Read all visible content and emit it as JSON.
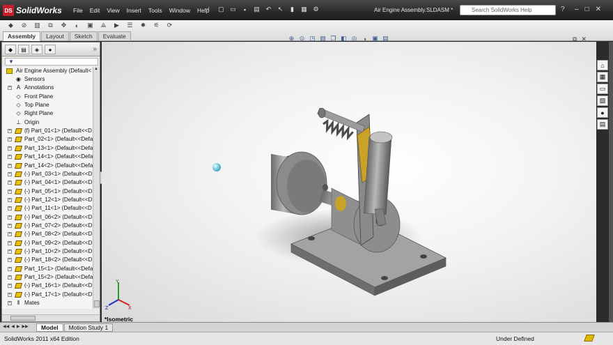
{
  "app": {
    "brand": "SolidWorks",
    "brand_badge": "DS"
  },
  "menu": [
    "File",
    "Edit",
    "View",
    "Insert",
    "Tools",
    "Window",
    "Help"
  ],
  "document_title": "Air Engine Assembly.SLDASM *",
  "search": {
    "placeholder": "Search SolidWorks Help"
  },
  "command_tabs": [
    {
      "label": "Assembly",
      "active": true
    },
    {
      "label": "Layout",
      "active": false
    },
    {
      "label": "Sketch",
      "active": false
    },
    {
      "label": "Evaluate",
      "active": false
    }
  ],
  "feature_tree": {
    "filter_symbol": "▼",
    "root": "Air Engine Assembly  (Default<",
    "items": [
      {
        "label": "Sensors",
        "icon": "sensors-icon",
        "expandable": false
      },
      {
        "label": "Annotations",
        "icon": "annotations-icon",
        "expandable": true
      },
      {
        "label": "Front Plane",
        "icon": "plane-icon",
        "expandable": false
      },
      {
        "label": "Top Plane",
        "icon": "plane-icon",
        "expandable": false
      },
      {
        "label": "Right Plane",
        "icon": "plane-icon",
        "expandable": false
      },
      {
        "label": "Origin",
        "icon": "origin-icon",
        "expandable": false
      },
      {
        "label": "(f) Part_01<1> (Default<<D",
        "icon": "part-icon",
        "expandable": true
      },
      {
        "label": "Part_02<1> (Default<<Defa",
        "icon": "part-icon",
        "expandable": true
      },
      {
        "label": "Part_13<1> (Default<<Defa",
        "icon": "part-icon",
        "expandable": true
      },
      {
        "label": "Part_14<1> (Default<<Defa",
        "icon": "part-icon",
        "expandable": true
      },
      {
        "label": "Part_14<2> (Default<<Defa",
        "icon": "part-icon",
        "expandable": true
      },
      {
        "label": "(-) Part_03<1> (Default<<D",
        "icon": "part-icon",
        "expandable": true
      },
      {
        "label": "(-) Part_04<1> (Default<<D",
        "icon": "part-icon",
        "expandable": true
      },
      {
        "label": "(-) Part_05<1> (Default<<D",
        "icon": "part-icon",
        "expandable": true
      },
      {
        "label": "(-) Part_12<1> (Default<<D",
        "icon": "part-icon",
        "expandable": true
      },
      {
        "label": "(-) Part_11<1> (Default<<D",
        "icon": "part-icon",
        "expandable": true
      },
      {
        "label": "(-) Part_06<2> (Default<<D",
        "icon": "part-icon",
        "expandable": true
      },
      {
        "label": "(-) Part_07<2> (Default<<D",
        "icon": "part-icon",
        "expandable": true
      },
      {
        "label": "(-) Part_08<2> (Default<<D",
        "icon": "part-icon",
        "expandable": true
      },
      {
        "label": "(-) Part_09<2> (Default<<D",
        "icon": "part-icon",
        "expandable": true
      },
      {
        "label": "(-) Part_10<2> (Default<<D",
        "icon": "part-icon",
        "expandable": true
      },
      {
        "label": "(-) Part_18<2> (Default<<D",
        "icon": "part-icon",
        "expandable": true
      },
      {
        "label": "Part_15<1> (Default<<Defa",
        "icon": "part-icon",
        "expandable": true
      },
      {
        "label": "Part_15<2> (Default<<Defa",
        "icon": "part-icon",
        "expandable": true
      },
      {
        "label": "(-) Part_16<1> (Default<<D",
        "icon": "part-icon",
        "expandable": true
      },
      {
        "label": "(-) Part_17<1> (Default<<D",
        "icon": "part-icon",
        "expandable": true
      },
      {
        "label": "Mates",
        "icon": "mates-icon",
        "expandable": true
      }
    ]
  },
  "viewport": {
    "view_label": "*Isometric",
    "triad": {
      "x": "X",
      "y": "Y",
      "z": "Z"
    }
  },
  "bottom_tabs": [
    {
      "label": "Model",
      "active": true
    },
    {
      "label": "Motion Study 1",
      "active": false
    }
  ],
  "status": {
    "edition": "SolidWorks 2011 x64 Edition",
    "units": "Under Defined"
  },
  "colors": {
    "accent_yellow": "#e8c010",
    "title_bg": "#2a2a2a",
    "viewport_bg": "#f2f2f2",
    "part_gray": "#8d8d8d"
  }
}
